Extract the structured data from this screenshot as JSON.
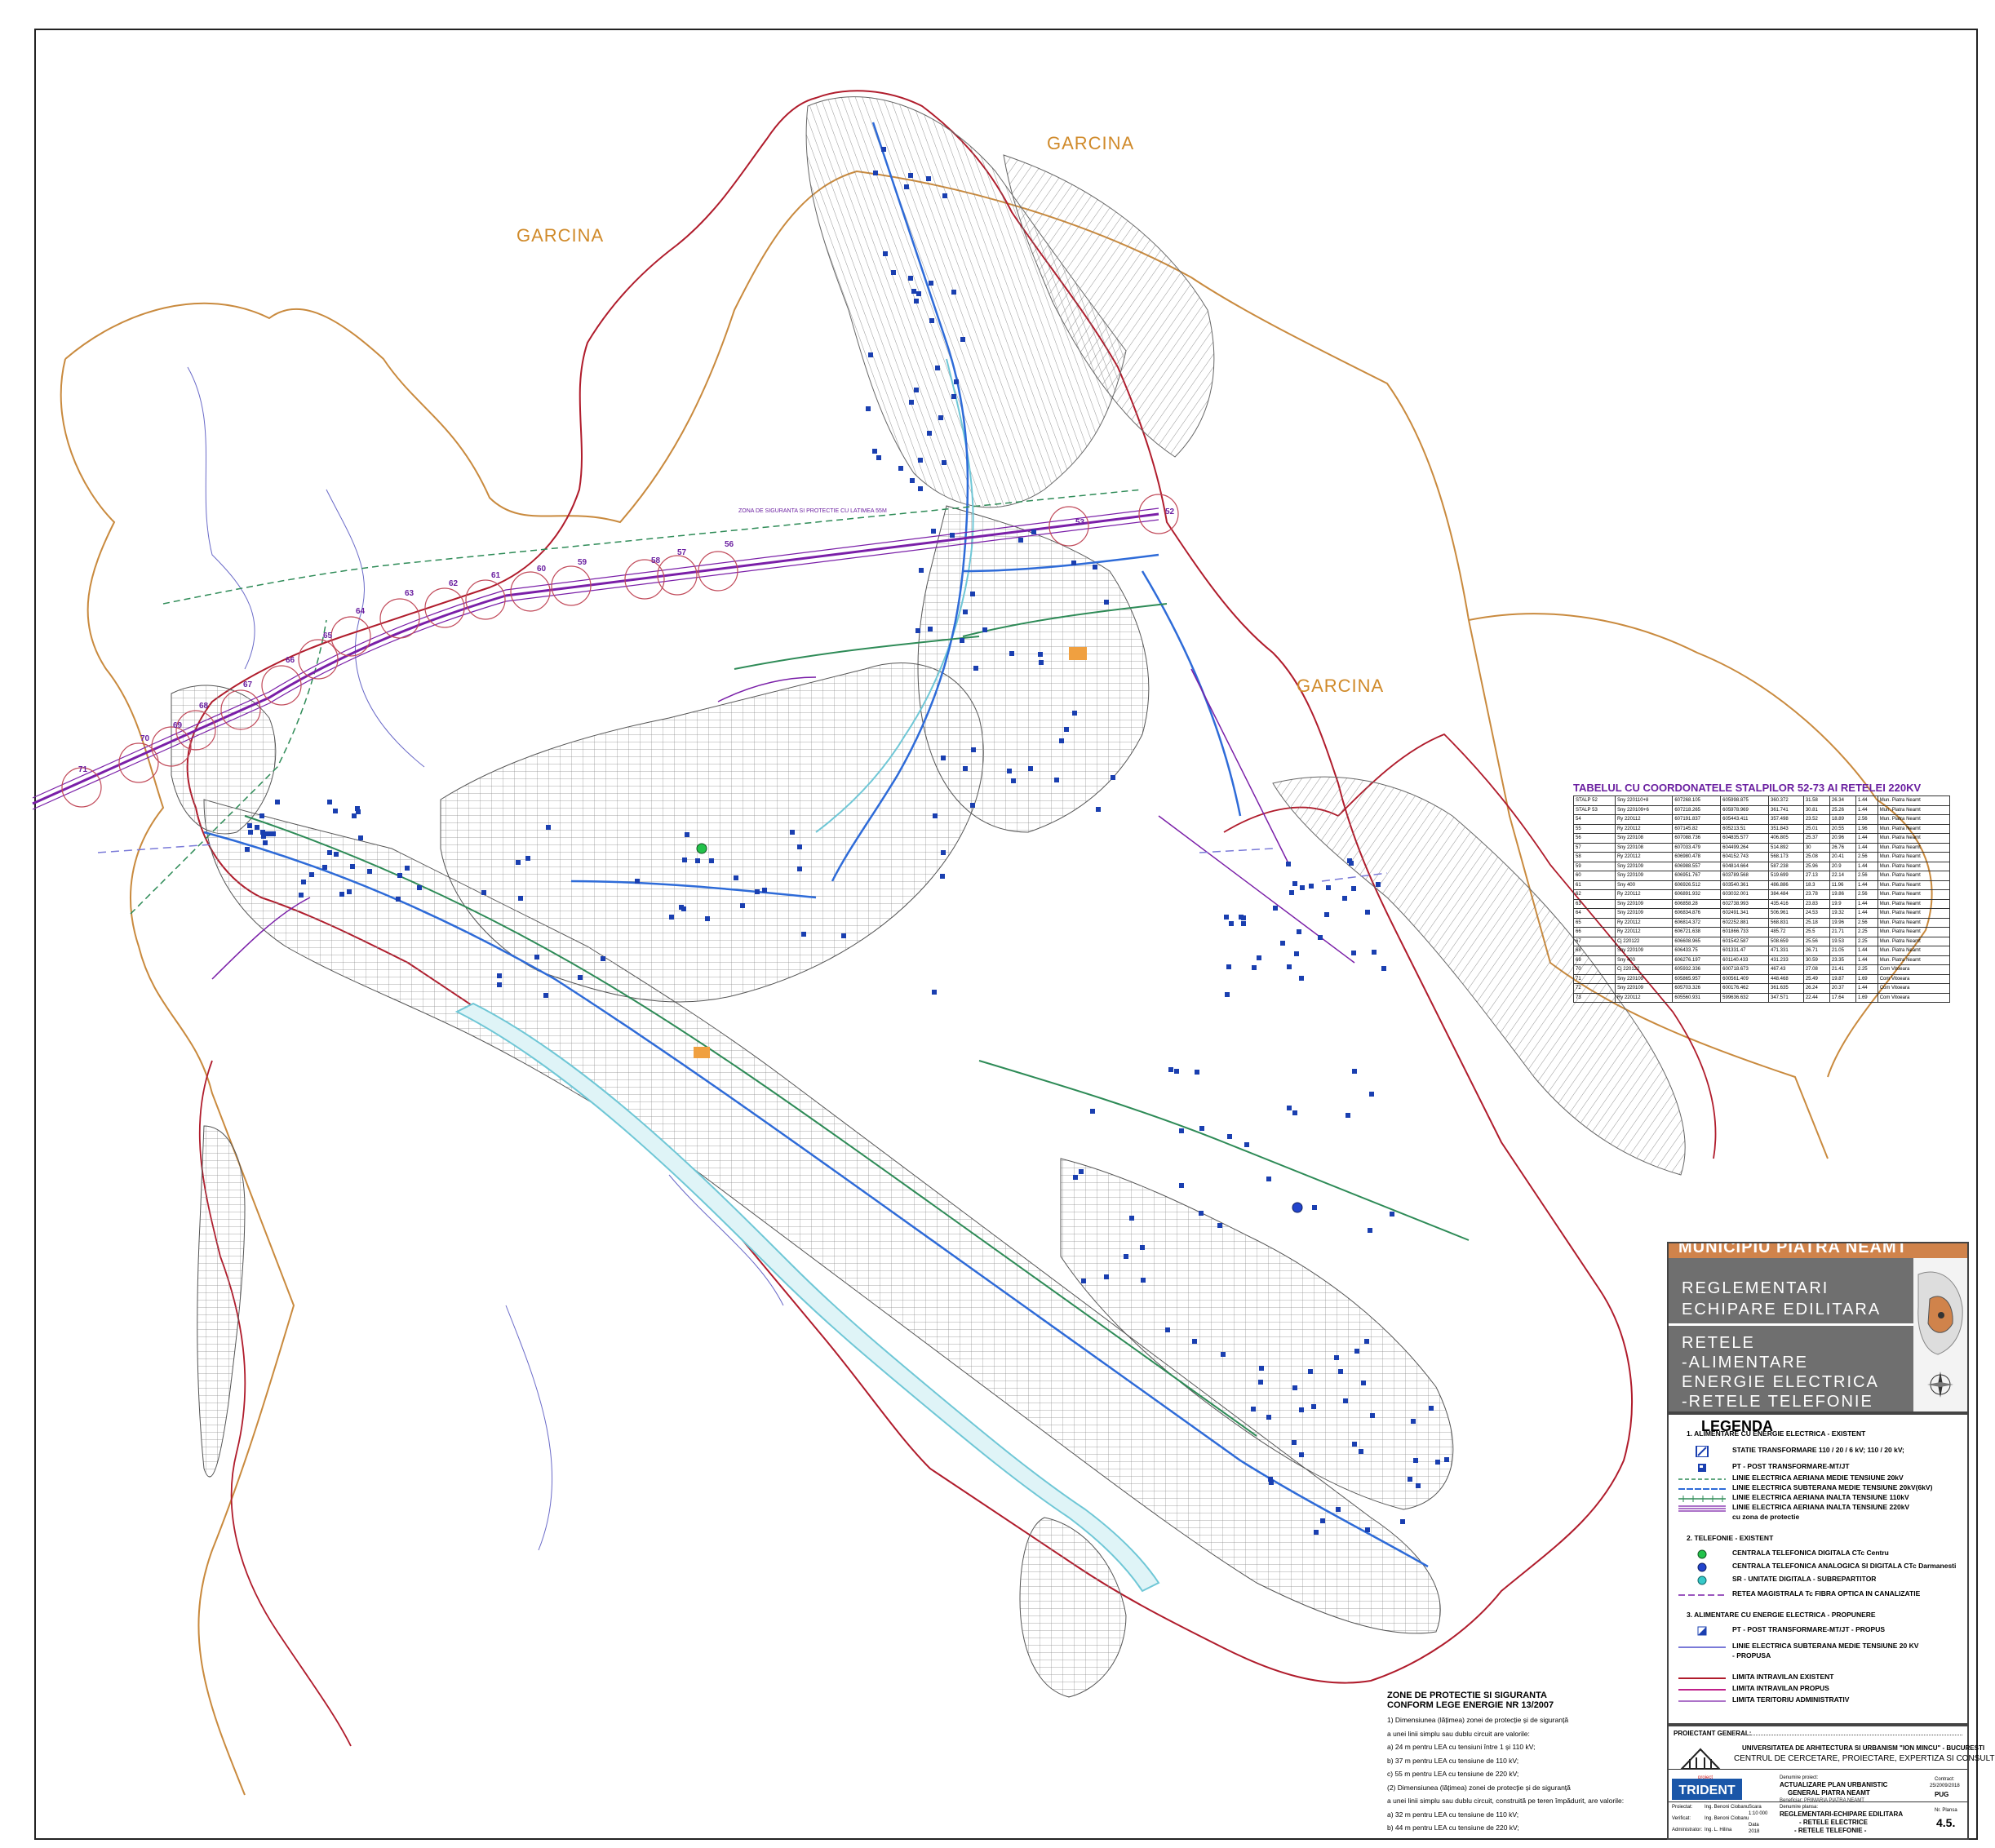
{
  "map": {
    "region_labels": [
      "GARCINA",
      "GARCINA",
      "GARCINA"
    ],
    "zone_note": "ZONA DE SIGURANTA SI PROTECTIE CU LATIMEA 55M",
    "pylon_numbers": [
      "52",
      "53",
      "56",
      "57",
      "58",
      "59",
      "60",
      "61",
      "62",
      "63",
      "64",
      "65",
      "66",
      "67",
      "68",
      "69",
      "70",
      "71"
    ]
  },
  "coord_table": {
    "title": "TABELUL CU COORDONATELE STALPILOR 52-73 AI RETELEI 220KV",
    "rows": [
      [
        "STALP 52",
        "Sny 220110+8",
        "607268.105",
        "605998.875",
        "360.372",
        "31.58",
        "26.34",
        "1.44",
        "Mun. Piatra Neamt"
      ],
      [
        "STALP 53",
        "Sny 220109+6",
        "607218.265",
        "605978.969",
        "361.741",
        "30.81",
        "25.26",
        "1.44",
        "Mun. Piatra Neamt"
      ],
      [
        "54",
        "Ry 220112",
        "607191.837",
        "605443.411",
        "357.498",
        "23.52",
        "18.89",
        "2.56",
        "Mun. Piatra Neamt"
      ],
      [
        "55",
        "Ry 220112",
        "607145.82",
        "605213.51",
        "351.843",
        "25.01",
        "20.55",
        "1.96",
        "Mun. Piatra Neamt"
      ],
      [
        "56",
        "Sny 220108",
        "607088.736",
        "604835.577",
        "406.805",
        "25.37",
        "20.96",
        "1.44",
        "Mun. Piatra Neamt"
      ],
      [
        "57",
        "Sny 220108",
        "607033.479",
        "604499.264",
        "514.892",
        "30",
        "26.76",
        "1.44",
        "Mun. Piatra Neamt"
      ],
      [
        "58",
        "Ry 220112",
        "606980.478",
        "604152.743",
        "568.173",
        "25.08",
        "20.41",
        "2.56",
        "Mun. Piatra Neamt"
      ],
      [
        "59",
        "Sny 220109",
        "606988.557",
        "604814.664",
        "587.238",
        "25.96",
        "20.9",
        "1.44",
        "Mun. Piatra Neamt"
      ],
      [
        "60",
        "Sny 220109",
        "606951.767",
        "603789.568",
        "519.699",
        "27.13",
        "22.14",
        "2.56",
        "Mun. Piatra Neamt"
      ],
      [
        "61",
        "Sny 400",
        "606926.512",
        "603540.361",
        "486.886",
        "18.3",
        "11.96",
        "1.44",
        "Mun. Piatra Neamt"
      ],
      [
        "62",
        "Ry 220112",
        "606891.932",
        "603032.001",
        "384.484",
        "23.78",
        "19.86",
        "2.56",
        "Mun. Piatra Neamt"
      ],
      [
        "63",
        "Sny 220109",
        "606858.28",
        "602738.993",
        "435.416",
        "23.83",
        "19.9",
        "1.44",
        "Mun. Piatra Neamt"
      ],
      [
        "64",
        "Sny 220109",
        "606834.876",
        "602491.341",
        "506.961",
        "24.53",
        "19.32",
        "1.44",
        "Mun. Piatra Neamt"
      ],
      [
        "65",
        "Ry 220112",
        "606814.372",
        "602252.881",
        "568.831",
        "25.18",
        "19.96",
        "2.56",
        "Mun. Piatra Neamt"
      ],
      [
        "66",
        "Ry 220112",
        "606721.638",
        "601866.733",
        "485.72",
        "25.5",
        "21.71",
        "2.25",
        "Mun. Piatra Neamt"
      ],
      [
        "67",
        "Cj 220122",
        "606608.965",
        "601542.587",
        "508.659",
        "25.56",
        "19.53",
        "2.25",
        "Mun. Piatra Neamt"
      ],
      [
        "68",
        "Sny 220109",
        "606433.75",
        "601331.47",
        "471.331",
        "26.71",
        "21.05",
        "1.44",
        "Mun. Piatra Neamt"
      ],
      [
        "69",
        "Sny 400",
        "606276.197",
        "601140.433",
        "431.233",
        "30.59",
        "23.35",
        "1.44",
        "Mun. Piatra Neamt"
      ],
      [
        "70",
        "Cj 220122",
        "605932.336",
        "600718.673",
        "467.43",
        "27.08",
        "21.41",
        "2.25",
        "Com Vitoeara"
      ],
      [
        "71",
        "Sny 220109",
        "605865.957",
        "600561.409",
        "448.468",
        "25.49",
        "19.87",
        "1.69",
        "Com Vitoeara"
      ],
      [
        "72",
        "Sny 220109",
        "605703.326",
        "600176.462",
        "361.635",
        "26.24",
        "20.37",
        "1.44",
        "Com Vitoeara"
      ],
      [
        "73",
        "Ry 220112",
        "605560.931",
        "599636.632",
        "347.571",
        "22.44",
        "17.64",
        "1.69",
        "Com Vitoeara"
      ]
    ]
  },
  "title_panel": {
    "municipality": "MUNICIPIU PIATRA NEAMT",
    "section_line1": "REGLEMENTARI",
    "section_line2": "ECHIPARE EDILITARA",
    "topic_line1": "RETELE",
    "topic_line2": "-ALIMENTARE",
    "topic_line3": "ENERGIE ELECTRICA",
    "topic_line4": "-RETELE TELEFONIE"
  },
  "legend": {
    "title": "LEGENDA",
    "items": [
      "1. ALIMENTARE CU ENERGIE ELECTRICA - EXISTENT",
      "STATIE TRANSFORMARE 110 / 20 / 6 kV; 110 / 20 kV;",
      "PT - POST TRANSFORMARE-MT/JT",
      "LINIE ELECTRICA AERIANA MEDIE TENSIUNE 20kV",
      "LINIE ELECTRICA SUBTERANA MEDIE TENSIUNE 20kV(6kV)",
      "LINIE ELECTRICA AERIANA INALTA TENSIUNE 110kV",
      "LINIE ELECTRICA AERIANA INALTA TENSIUNE 220kV",
      "cu zona de protectie",
      "2. TELEFONIE - EXISTENT",
      "CENTRALA TELEFONICA DIGITALA CTc Centru",
      "CENTRALA TELEFONICA ANALOGICA SI DIGITALA CTc Darmanesti",
      "SR - UNITATE DIGITALA - SUBREPARTITOR",
      "RETEA MAGISTRALA Tc FIBRA OPTICA IN CANALIZATIE",
      "3. ALIMENTARE CU ENERGIE ELECTRICA - PROPUNERE",
      "PT - POST TRANSFORMARE-MT/JT - PROPUS",
      "LINIE ELECTRICA SUBTERANA MEDIE TENSIUNE 20 KV",
      "- PROPUSA",
      "LIMITA INTRAVILAN EXISTENT",
      "LIMITA INTRAVILAN PROPUS",
      "LIMITA TERITORIU ADMINISTRATIV"
    ]
  },
  "zones": {
    "title1": "ZONE DE PROTECTIE SI SIGURANTA",
    "title2": "CONFORM LEGE ENERGIE NR 13/2007",
    "items": [
      "1)   Dimensiunea (lățimea) zonei de protecție și de siguranță",
      "a unei linii simplu sau dublu circuit are valorile:",
      "a)  24 m pentru LEA cu tensiuni între 1 și 110 kV;",
      "b)  37 m pentru LEA cu tensiune de 110 kV;",
      "c)  55 m pentru LEA cu tensiune de 220 kV;",
      "(2)   Dimensiunea (lățimea) zonei de protecție și de siguranță",
      "a unei linii simplu sau dublu circuit, construită pe teren împădurit, are valorile:",
      "a)  32 m pentru LEA cu tensiune de 110 kV;",
      "b)  44 m pentru LEA cu tensiune de 220 kV;"
    ]
  },
  "titleblock": {
    "proiectant": "PROIECTANT GENERAL:",
    "univ": "UNIVERSITATEA DE ARHITECTURA SI URBANISM \"ION MINCU\" - BUCURESTI",
    "centru": "CENTRUL DE CERCETARE, PROIECTARE, EXPERTIZA SI CONSULTING",
    "subproiectant": "proiect",
    "trident": "TRIDENT",
    "proiect_label": "Denumire proiect:",
    "proiect1": "ACTUALIZARE PLAN URBANISTIC",
    "proiect2": "GENERAL PIATRA NEAMT",
    "beneficiar": "Beneficiar:  PRIMARIA PIATRA NEAMT",
    "plansa_label": "Denumire plansa:",
    "plansa1": "REGLEMENTARI-ECHIPARE EDILITARA",
    "plansa2": "- RETELE ELECTRICE",
    "plansa3": "- RETELE TELEFONIE -",
    "contract": "Contract:",
    "contract_nr": "25/2009/2018",
    "faza": "PUG",
    "plansa_nr_label": "Nr. Plansa",
    "plansa_nr": "4.5.",
    "roles": [
      "Proiectat:",
      "Verificat:",
      "Administrator:"
    ],
    "names": [
      "Ing. Benoni Ciobanu",
      "Ing. Benoni Ciobanu",
      "Ing. L. Hilina"
    ],
    "scara_label": "Scara",
    "scara": "1:10 000",
    "data_label": "Data",
    "data": "2018"
  },
  "colors": {
    "admin_limit": "#c98a3e",
    "intravilan": "#b01c2c",
    "hv_220": "#7a1fa8",
    "mv_line": "#2e6bd8",
    "green_line": "#2e8b57",
    "river": "#6fc7d6"
  }
}
